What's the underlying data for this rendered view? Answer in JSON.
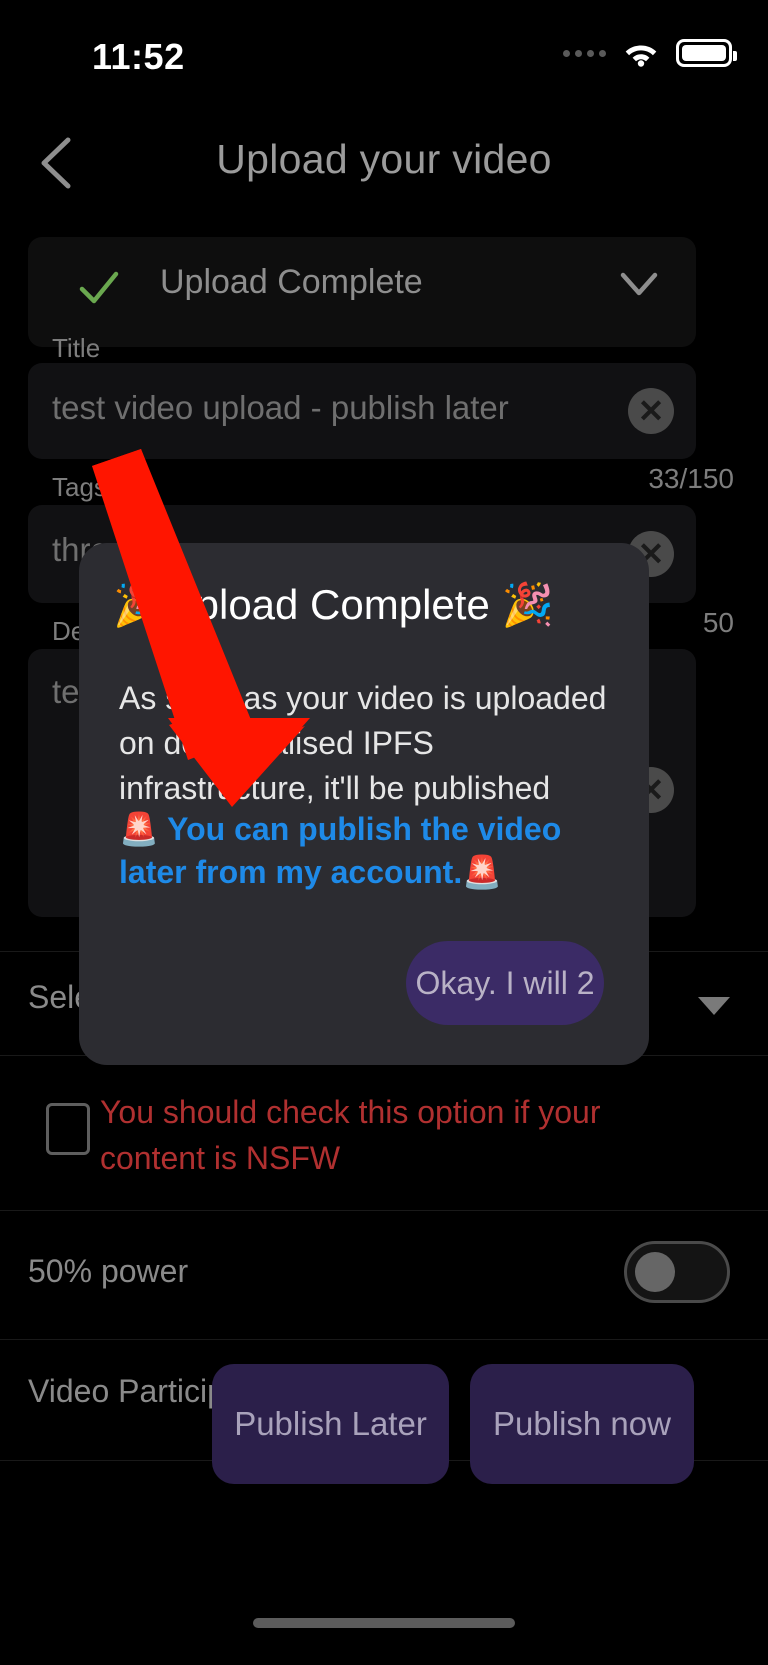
{
  "status_bar": {
    "time": "11:52",
    "signal_icon": "signal-dots-icon",
    "wifi_icon": "wifi-icon",
    "battery_icon": "battery-full-icon"
  },
  "header": {
    "back_icon": "chevron-left-icon",
    "title": "Upload your video"
  },
  "upload_status": {
    "check_icon": "check-icon",
    "label": "Upload Complete",
    "expand_icon": "chevron-down-icon"
  },
  "fields": {
    "title": {
      "label": "Title",
      "value": "test video upload - publish later",
      "clear_icon": "close-circle-icon",
      "counter": "33/150"
    },
    "tags": {
      "label": "Tags",
      "value": "thre",
      "clear_icon": "close-circle-icon",
      "counter": "50"
    },
    "description": {
      "label": "De",
      "value": "te",
      "clear_icon": "close-circle-icon"
    }
  },
  "select_row": {
    "label": "Sele",
    "caret_icon": "caret-down-icon"
  },
  "nsfw": {
    "checkbox_icon": "checkbox-unchecked-icon",
    "text": "You should check this option if your content is NSFW",
    "color": "#b03030"
  },
  "power": {
    "label": "50% power",
    "toggle_icon": "toggle-off-icon"
  },
  "participants": {
    "label": "Video Participa"
  },
  "bottom_actions": {
    "publish_later": "Publish Later",
    "publish_now": "Publish now",
    "accent": "#2b1f4a"
  },
  "modal": {
    "title": "🎉Upload Complete 🎉",
    "body": "As soon as your video is uploaded on decentralised IPFS infrastructure, it'll be published",
    "highlight": "🚨 You can publish the video later from my account.🚨",
    "highlight_color": "#1e8ae8",
    "ok_label": "Okay. I will 2",
    "ok_color": "#3b2b66"
  },
  "annotation": {
    "arrow_icon": "red-arrow-annotation",
    "color": "#FF1500"
  },
  "home_indicator": "home-indicator"
}
